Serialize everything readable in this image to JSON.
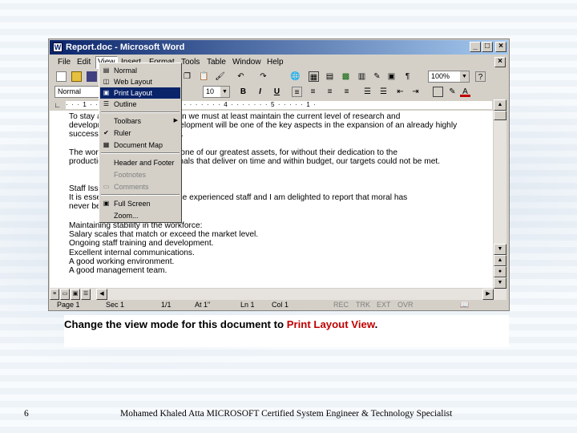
{
  "window": {
    "title": "Report.doc - Microsoft Word",
    "minimize": "_",
    "maximize": "□",
    "close": "×"
  },
  "menubar": {
    "items": [
      "File",
      "Edit",
      "View",
      "Insert",
      "Format",
      "Tools",
      "Table",
      "Window",
      "Help"
    ],
    "close_doc": "×"
  },
  "toolbar": {
    "zoom": "100%",
    "style": "Normal",
    "font_size": "10",
    "bold": "B",
    "italic": "I",
    "underline": "U",
    "help": "?"
  },
  "ruler": {
    "scale": "·  ·  ·  1  ·  ·  ·  ·  ·  ·  ·  2  ·  ·  ·  ·  ·  ·  ·  3  ·  ·  ·  ·  ·  ·  ·  4  ·  ·  ·  ·  ·  ·  ·  5  ·  ·  ·  ·  ·  1  ·"
  },
  "view_menu": {
    "items": [
      {
        "label": "Normal",
        "icon": "normal-view-icon",
        "state": "normal"
      },
      {
        "label": "Web Layout",
        "icon": "web-layout-icon",
        "state": "normal"
      },
      {
        "label": "Print Layout",
        "icon": "print-layout-icon",
        "state": "selected"
      },
      {
        "label": "Outline",
        "icon": "outline-view-icon",
        "state": "normal"
      },
      {
        "label": "Toolbars",
        "icon": "",
        "state": "submenu"
      },
      {
        "label": "Ruler",
        "icon": "checkmark-icon",
        "state": "checked"
      },
      {
        "label": "Document Map",
        "icon": "document-map-icon",
        "state": "normal"
      },
      {
        "label": "Header and Footer",
        "icon": "",
        "state": "normal"
      },
      {
        "label": "Footnotes",
        "icon": "",
        "state": "disabled"
      },
      {
        "label": "Comments",
        "icon": "comments-icon",
        "state": "disabled"
      },
      {
        "label": "Full Screen",
        "icon": "full-screen-icon",
        "state": "normal"
      },
      {
        "label": "Zoom...",
        "icon": "",
        "state": "normal"
      }
    ]
  },
  "document": {
    "lines": [
      "To stay ahead of the competition we must at least maintain the current level of research and",
      "development. Research & Development will be one of the key aspects in the expansion of an already highly",
      "successful portfolio of products.",
      "The workforce continues to be one of our greatest assets, for without their dedication to the",
      "production of quality, professionals that deliver on time and within budget, our targets could not be met.",
      "Staff Issues",
      "It is essential that we do not lose experienced staff and I am delighted to report that moral has",
      "never been higher.",
      "Maintaining stability in the workforce:",
      "Salary scales that match or exceed the market level.",
      "Ongoing staff training and development.",
      "Excellent internal communications.",
      "A good working environment.",
      "A good management team."
    ]
  },
  "statusbar": {
    "page": "Page  1",
    "sec": "Sec  1",
    "pages": "1/1",
    "at": "At  1\"",
    "ln": "Ln  1",
    "col": "Col  1",
    "rec": "REC",
    "trk": "TRK",
    "ext": "EXT",
    "ovr": "OVR"
  },
  "caption": {
    "text": "Change the view mode for this document to ",
    "highlight": "Print Layout View",
    "end": "."
  },
  "footer": {
    "slide_number": "6",
    "credit": "Mohamed Khaled Atta MICROSOFT Certified System Engineer & Technology Specialist"
  },
  "colors": {
    "titlebar_start": "#0a246a",
    "titlebar_end": "#a6caf0",
    "menu_selected": "#0a246a",
    "caption_highlight": "#c00000"
  }
}
